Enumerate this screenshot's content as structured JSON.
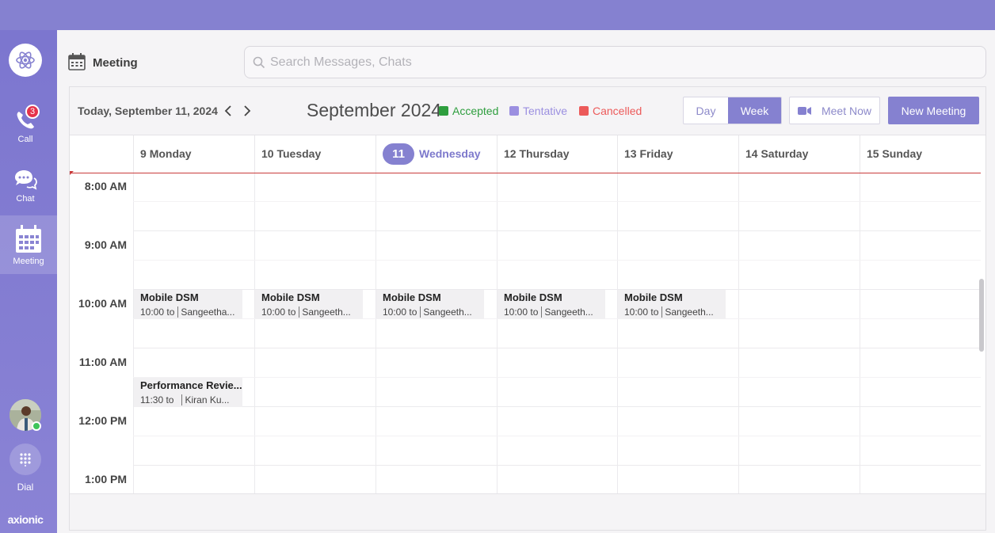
{
  "sidebar": {
    "items": [
      {
        "label": "Call",
        "badge": "3"
      },
      {
        "label": "Chat"
      },
      {
        "label": "Meeting"
      }
    ],
    "dial_label": "Dial",
    "brand": "axionic"
  },
  "header": {
    "title": "Meeting",
    "search_placeholder": "Search Messages, Chats"
  },
  "toolbar": {
    "today": "Today, September 11, 2024",
    "month": "September 2024",
    "legend": [
      {
        "label": "Accepted",
        "color": "#2e9e3e"
      },
      {
        "label": "Tentative",
        "color": "#9b8fe0"
      },
      {
        "label": "Cancelled",
        "color": "#ec5a5a"
      }
    ],
    "view_day": "Day",
    "view_week": "Week",
    "meet_now": "Meet Now",
    "new_meeting": "New Meeting"
  },
  "calendar": {
    "days": [
      {
        "num": "9",
        "name": "Monday"
      },
      {
        "num": "10",
        "name": "Tuesday"
      },
      {
        "num": "11",
        "name": "Wednesday",
        "today": true
      },
      {
        "num": "12",
        "name": "Thursday"
      },
      {
        "num": "13",
        "name": "Friday"
      },
      {
        "num": "14",
        "name": "Saturday"
      },
      {
        "num": "15",
        "name": "Sunday"
      }
    ],
    "times": [
      "8:00 AM",
      "9:00 AM",
      "10:00 AM",
      "11:00 AM",
      "12:00 PM",
      "1:00 PM"
    ],
    "events": [
      {
        "title": "Mobile DSM",
        "time": "10:00 to",
        "host": "Sangeetha..."
      },
      {
        "title": "Mobile DSM",
        "time": "10:00 to",
        "host": "Sangeeth..."
      },
      {
        "title": "Mobile DSM",
        "time": "10:00 to",
        "host": "Sangeeth..."
      },
      {
        "title": "Mobile DSM",
        "time": "10:00 to",
        "host": "Sangeeth..."
      },
      {
        "title": "Mobile DSM",
        "time": "10:00 to",
        "host": "Sangeeth..."
      },
      {
        "title": "Performance Revie...",
        "time": "11:30 to",
        "host": "Kiran Ku..."
      }
    ]
  }
}
